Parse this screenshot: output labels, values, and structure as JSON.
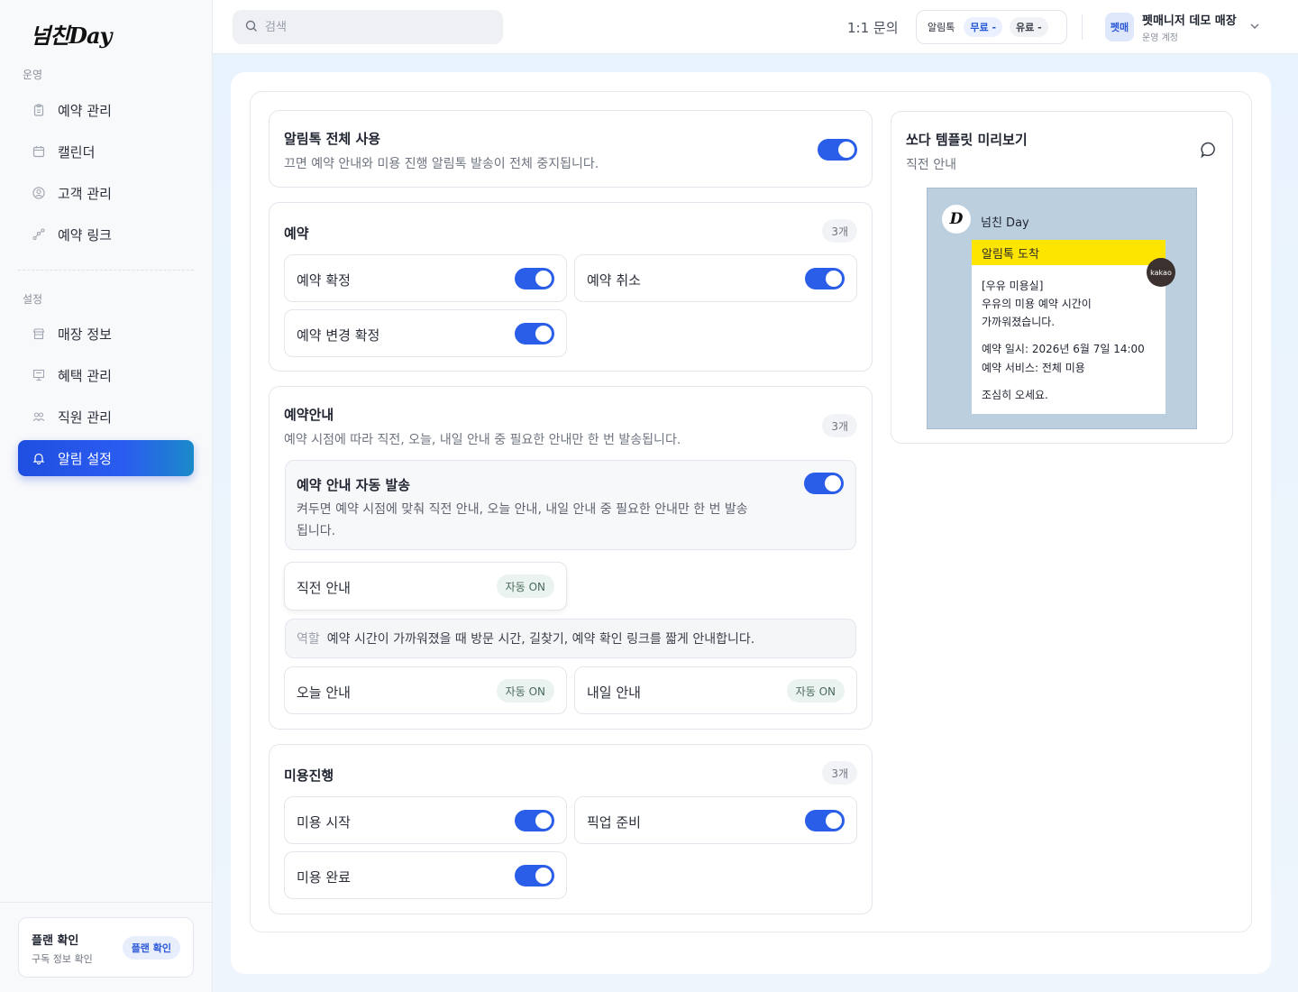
{
  "sidebar": {
    "logo": "넘친Day",
    "section_ops": "운영",
    "section_settings": "설정",
    "ops_items": [
      {
        "label": "예약 관리",
        "icon": "clipboard-icon"
      },
      {
        "label": "캘린더",
        "icon": "calendar-icon"
      },
      {
        "label": "고객 관리",
        "icon": "user-circle-icon"
      },
      {
        "label": "예약 링크",
        "icon": "link-nodes-icon"
      }
    ],
    "settings_items": [
      {
        "label": "매장 정보",
        "icon": "store-icon"
      },
      {
        "label": "혜택 관리",
        "icon": "presentation-icon"
      },
      {
        "label": "직원 관리",
        "icon": "users-icon"
      },
      {
        "label": "알림 설정",
        "icon": "bell-icon",
        "active": true
      }
    ],
    "plan": {
      "title": "플랜 확인",
      "sub": "구독 정보 확인",
      "button": "플랜 확인"
    }
  },
  "topbar": {
    "search_placeholder": "검색",
    "inquiry": "1:1 문의",
    "alimtalk_label": "알림톡",
    "free_pill": "무료 -",
    "paid_pill": "유료 -",
    "account_avatar": "펫매",
    "account_name": "펫매니저 데모 매장",
    "account_role": "운영 계정"
  },
  "master": {
    "title": "알림톡 전체 사용",
    "desc": "끄면 예약 안내와 미용 진행 알림톡 발송이 전체 중지됩니다.",
    "enabled": true
  },
  "booking": {
    "title": "예약",
    "count": "3개",
    "items": [
      {
        "label": "예약 확정",
        "on": true
      },
      {
        "label": "예약 취소",
        "on": true
      },
      {
        "label": "예약 변경 확정",
        "on": true
      }
    ]
  },
  "guide": {
    "title": "예약안내",
    "desc": "예약 시점에 따라 직전, 오늘, 내일 안내 중 필요한 안내만 한 번 발송됩니다.",
    "count": "3개",
    "auto_title": "예약 안내 자동 발송",
    "auto_desc": "켜두면 예약 시점에 맞춰 직전 안내, 오늘 안내, 내일 안내 중 필요한 안내만 한 번 발송됩니다.",
    "auto_on": true,
    "items": [
      {
        "label": "직전 안내",
        "badge": "자동 ON"
      },
      {
        "label": "오늘 안내",
        "badge": "자동 ON"
      },
      {
        "label": "내일 안내",
        "badge": "자동 ON"
      }
    ],
    "role_key": "역할",
    "role_value": "예약 시간이 가까워졌을 때 방문 시간, 길찾기, 예약 확인 링크를 짧게 안내합니다."
  },
  "grooming": {
    "title": "미용진행",
    "count": "3개",
    "items": [
      {
        "label": "미용 시작",
        "on": true
      },
      {
        "label": "픽업 준비",
        "on": true
      },
      {
        "label": "미용 완료",
        "on": true
      }
    ]
  },
  "preview": {
    "title": "쏘다 템플릿 미리보기",
    "sub": "직전 안내",
    "sender": "넘친 Day",
    "avatar_text": "D",
    "header": "알림톡 도착",
    "lines": [
      "[우유 미용실]",
      "우유의 미용 예약 시간이",
      "가까워졌습니다.",
      "예약 일시: 2026년 6월 7일 14:00",
      "예약 서비스: 전체 미용",
      "조심히 오세요."
    ],
    "kakao_badge": "kakao",
    "bg_color": "#bccfdf",
    "header_color": "#fee500"
  },
  "colors": {
    "accent": "#2a5ee8",
    "toggle_on": "#2a5ee8"
  }
}
